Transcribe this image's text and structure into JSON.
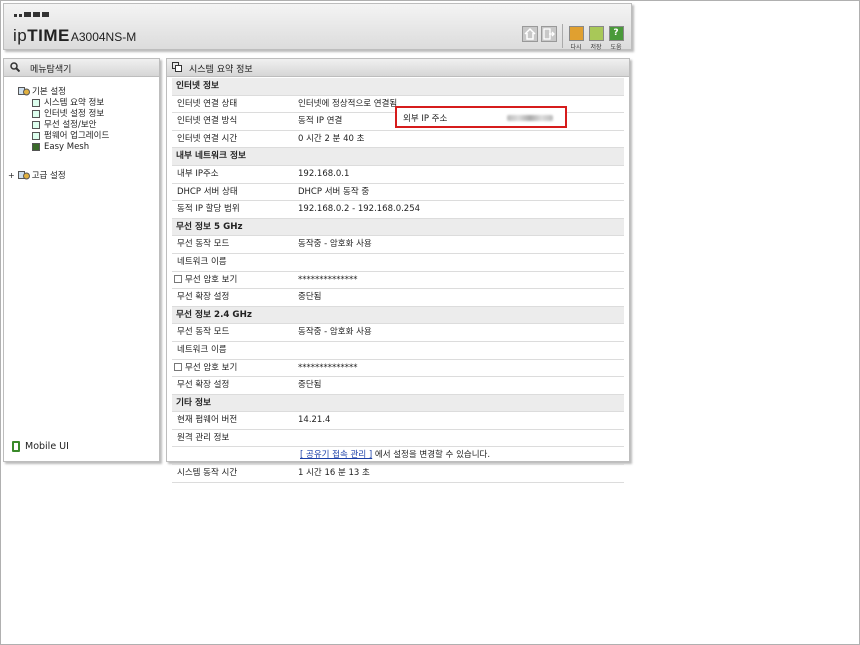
{
  "header": {
    "brand_prefix": "ip",
    "brand_bold": "TIME",
    "model": "A3004NS-M",
    "buttons": [
      {
        "label": "다시"
      },
      {
        "label": "저장"
      },
      {
        "label": "도움"
      }
    ]
  },
  "sidebar": {
    "title": "메뉴탐색기",
    "basic": {
      "label": "기본 설정",
      "items": [
        "시스템 요약 정보",
        "인터넷 설정 정보",
        "무선 설정/보안",
        "펌웨어 업그레이드",
        "Easy Mesh"
      ]
    },
    "advanced": {
      "label": "고급 설정"
    },
    "mobile_label": "Mobile UI"
  },
  "main": {
    "title": "시스템 요약 정보",
    "internet": {
      "header": "인터넷 정보",
      "status_label": "인터넷 연결 상태",
      "status_value": "인터넷에 정상적으로 연결됨",
      "method_label": "인터넷 연결 방식",
      "method_value": "동적 IP 연결",
      "time_label": "인터넷 연결 시간",
      "time_value": "0 시간 2 분 40 초",
      "external_ip_label": "외부 IP 주소"
    },
    "lan": {
      "header": "내부 네트워크 정보",
      "ip_label": "내부 IP주소",
      "ip_value": "192.168.0.1",
      "dhcp_label": "DHCP 서버 상태",
      "dhcp_value": "DHCP 서버 동작 중",
      "range_label": "동적 IP 할당 범위",
      "range_value": "192.168.0.2 -  192.168.0.254"
    },
    "wifi5": {
      "header": "무선 정보 5 GHz",
      "mode_label": "무선 동작 모드",
      "mode_value": "동작중 - 암호화 사용",
      "ssid_label": "네트워크 이름",
      "ssid_value": "",
      "pw_label": "무선 암호 보기",
      "pw_value": "**************",
      "ext_label": "무선 확장 설정",
      "ext_value": "중단됨"
    },
    "wifi24": {
      "header": "무선 정보 2.4 GHz",
      "mode_label": "무선 동작 모드",
      "mode_value": "동작중 - 암호화 사용",
      "ssid_label": "네트워크 이름",
      "ssid_value": "",
      "pw_label": "무선 암호 보기",
      "pw_value": "**************",
      "ext_label": "무선 확장 설정",
      "ext_value": "중단됨"
    },
    "etc": {
      "header": "기타 정보",
      "fw_label": "현재 펌웨어 버전",
      "fw_value": "14.21.4",
      "remote_label": "원격 관리 정보",
      "remote_link": "[ 공유기 접속 관리 ]",
      "remote_text": " 에서 설정을 변경할 수 있습니다.",
      "uptime_label": "시스템 동작 시간",
      "uptime_value": "1 시간 16 분 13 초"
    }
  }
}
